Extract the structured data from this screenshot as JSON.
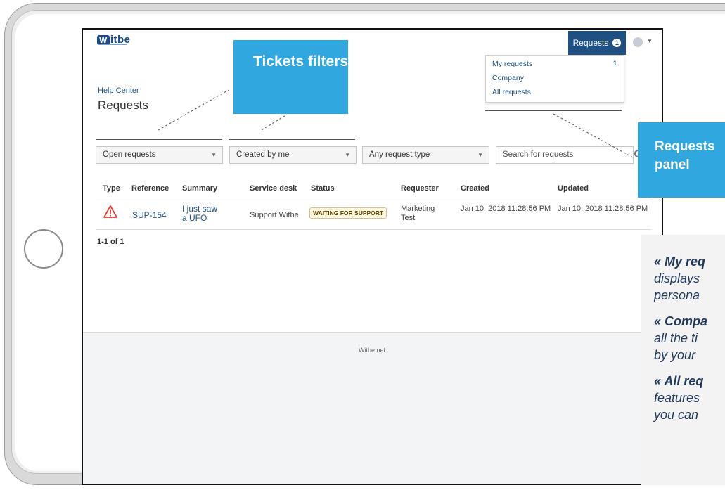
{
  "header": {
    "logo": "Witbe",
    "requests_button": "Requests",
    "requests_count": "1"
  },
  "requests_menu": {
    "items": [
      {
        "label": "My requests",
        "count": "1"
      },
      {
        "label": "Company"
      },
      {
        "label": "All requests"
      }
    ]
  },
  "page": {
    "breadcrumb": "Help Center",
    "title": "Requests"
  },
  "filters": {
    "status": "Open requests",
    "creator": "Created by me",
    "type": "Any request type",
    "search_placeholder": "Search for requests"
  },
  "table": {
    "headers": [
      "Type",
      "Reference",
      "Summary",
      "Service desk",
      "Status",
      "Requester",
      "Created",
      "Updated"
    ],
    "rows": [
      {
        "type_icon": "warning-icon",
        "reference": "SUP-154",
        "summary": "I just saw a UFO",
        "service_desk": "Support Witbe",
        "status": "WAITING FOR SUPPORT",
        "requester": "Marketing Test",
        "created": "Jan 10, 2018 11:28:56 PM",
        "updated": "Jan 10, 2018 11:28:56 PM"
      }
    ],
    "pagination": "1-1 of 1"
  },
  "footer": {
    "text": "Witbe.net"
  },
  "callouts": {
    "tickets_filters": "Tickets filters",
    "requests_panel": "Requests panel",
    "notes": [
      {
        "bold": "« My req",
        "rest": ""
      },
      {
        "bold": "",
        "rest": "displays"
      },
      {
        "bold": "",
        "rest": "persona"
      },
      {
        "bold": "« Compa",
        "rest": ""
      },
      {
        "bold": "",
        "rest": "all the ti"
      },
      {
        "bold": "",
        "rest": "by your"
      },
      {
        "bold": "« All req",
        "rest": ""
      },
      {
        "bold": "",
        "rest": "features"
      },
      {
        "bold": "",
        "rest": "you can"
      }
    ]
  },
  "colors": {
    "brand": "#205081",
    "callout": "#30a8df",
    "status_badge_bg": "#fff7e0",
    "warning": "#e53935"
  }
}
